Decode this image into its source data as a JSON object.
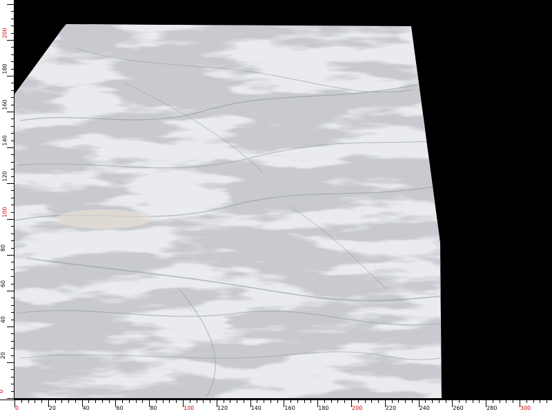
{
  "ruler": {
    "x_labels": [
      "0",
      "20",
      "40",
      "60",
      "80",
      "100",
      "120",
      "140",
      "160",
      "180",
      "200",
      "220",
      "240",
      "260",
      "280",
      "300"
    ],
    "y_labels": [
      "0",
      "20",
      "40",
      "60",
      "80",
      "100",
      "120",
      "140",
      "160",
      "180",
      "200"
    ],
    "major_color": "#d00000",
    "minor_color": "#000000"
  },
  "slab": {
    "description_icon": "marble-slab-image",
    "base_color": "#e9ebee",
    "vein_color": "#8b8f98"
  }
}
